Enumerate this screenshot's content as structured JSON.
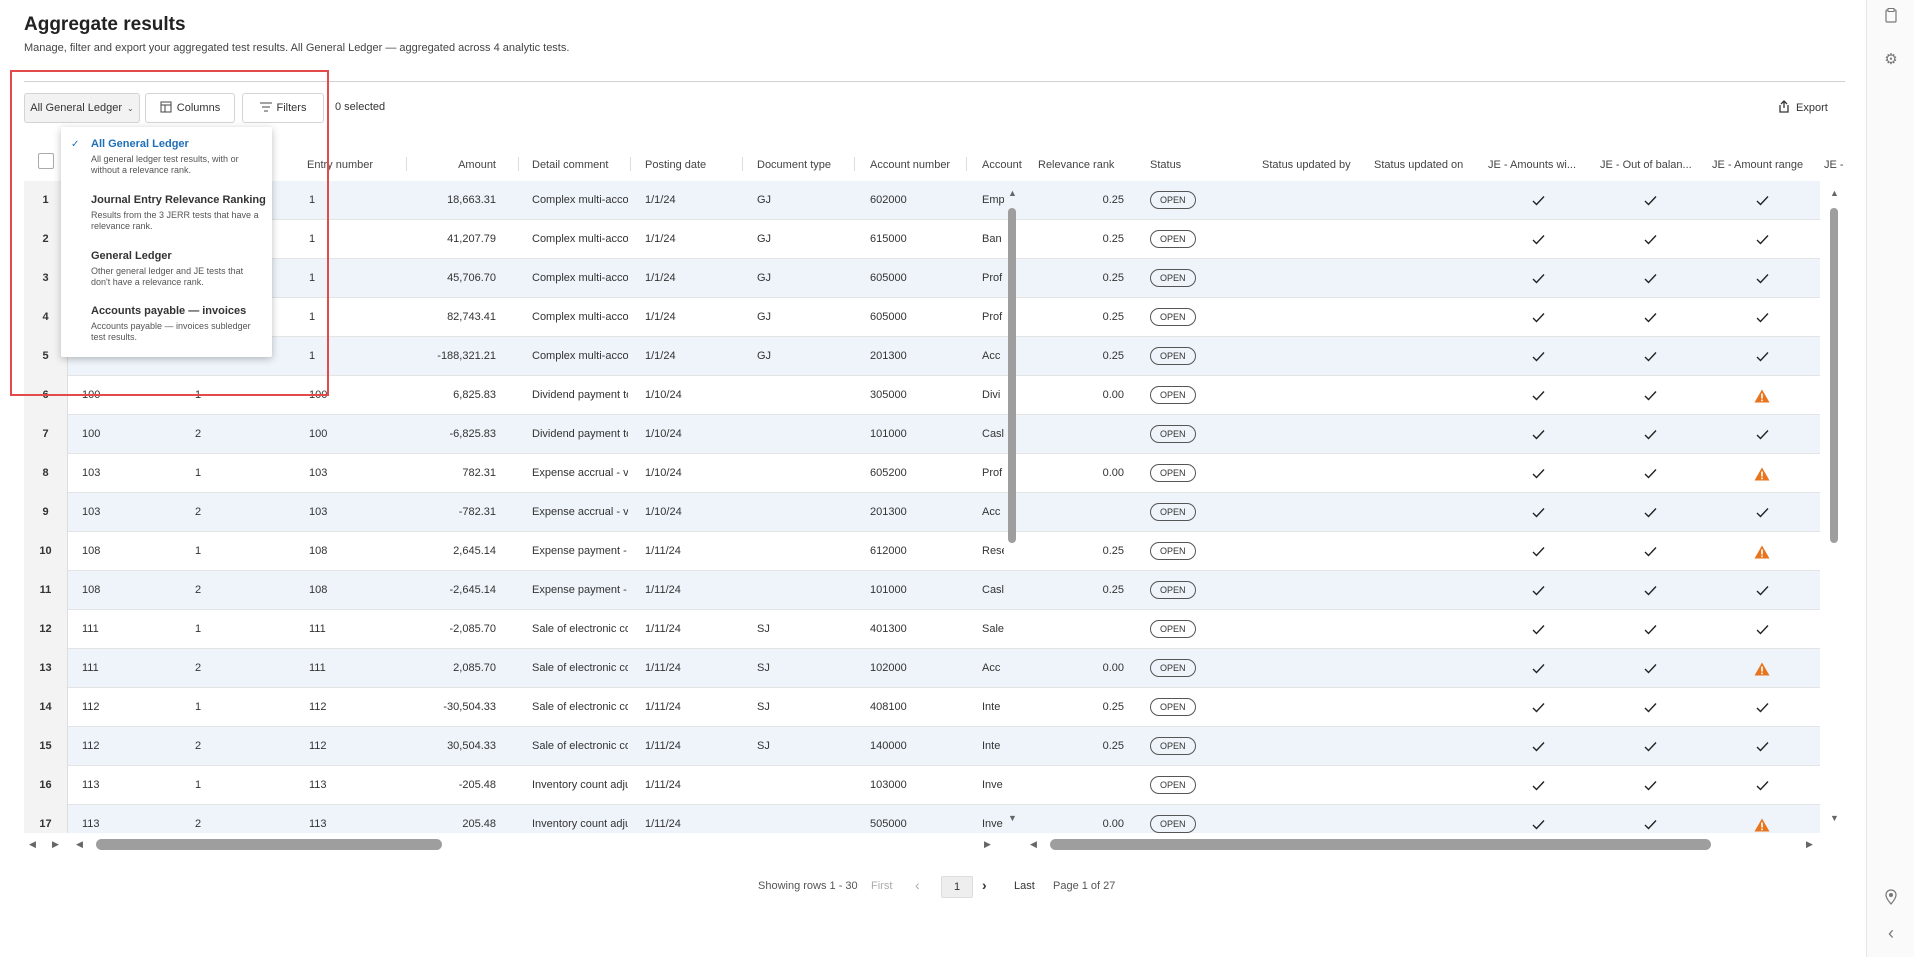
{
  "page": {
    "title": "Aggregate results",
    "description": "Manage, filter and export your aggregated test results. All General Ledger — aggregated across 4 analytic tests."
  },
  "toolbar": {
    "dataset_selector": "All General Ledger",
    "columns_label": "Columns",
    "filters_label": "Filters",
    "selected_count": "0 selected",
    "export_label": "Export"
  },
  "dropdown": {
    "items": [
      {
        "title": "All General Ledger",
        "description": "All general ledger test results, with or without a relevance rank.",
        "selected": true
      },
      {
        "title": "Journal Entry Relevance Ranking",
        "description": "Results from the 3 JERR tests that have a relevance rank.",
        "selected": false
      },
      {
        "title": "General Ledger",
        "description": "Other general ledger and JE tests that don't have a relevance rank.",
        "selected": false
      },
      {
        "title": "Accounts payable — invoices",
        "description": "Accounts payable — invoices subledger test results.",
        "selected": false
      }
    ]
  },
  "table": {
    "columns": {
      "entry_number": "Entry number",
      "amount": "Amount",
      "detail_comment": "Detail comment",
      "posting_date": "Posting date",
      "document_type": "Document type",
      "account_number": "Account number",
      "account": "Account",
      "relevance_rank": "Relevance rank",
      "status": "Status",
      "status_updated_by": "Status updated by",
      "status_updated_on": "Status updated on",
      "je_amounts": "JE - Amounts wi...",
      "je_out_of_balance": "JE - Out of balan...",
      "je_amount_range": "JE - Amount range",
      "je_more": "JE -"
    },
    "rows": [
      {
        "n": "1",
        "c1": "",
        "c2": "",
        "entry": "1",
        "amount": "18,663.31",
        "comment": "Complex multi-accou",
        "date": "1/1/24",
        "doc": "GJ",
        "acct_no": "602000",
        "acct": "Emp",
        "rank": "0.25",
        "status": "OPEN",
        "t1": "check",
        "t2": "check",
        "t3": "check"
      },
      {
        "n": "2",
        "c1": "",
        "c2": "",
        "entry": "1",
        "amount": "41,207.79",
        "comment": "Complex multi-accou",
        "date": "1/1/24",
        "doc": "GJ",
        "acct_no": "615000",
        "acct": "Ban",
        "rank": "0.25",
        "status": "OPEN",
        "t1": "check",
        "t2": "check",
        "t3": "check"
      },
      {
        "n": "3",
        "c1": "",
        "c2": "",
        "entry": "1",
        "amount": "45,706.70",
        "comment": "Complex multi-accou",
        "date": "1/1/24",
        "doc": "GJ",
        "acct_no": "605000",
        "acct": "Prof",
        "rank": "0.25",
        "status": "OPEN",
        "t1": "check",
        "t2": "check",
        "t3": "check"
      },
      {
        "n": "4",
        "c1": "",
        "c2": "",
        "entry": "1",
        "amount": "82,743.41",
        "comment": "Complex multi-accou",
        "date": "1/1/24",
        "doc": "GJ",
        "acct_no": "605000",
        "acct": "Prof",
        "rank": "0.25",
        "status": "OPEN",
        "t1": "check",
        "t2": "check",
        "t3": "check"
      },
      {
        "n": "5",
        "c1": "",
        "c2": "",
        "entry": "1",
        "amount": "-188,321.21",
        "comment": "Complex multi-accou",
        "date": "1/1/24",
        "doc": "GJ",
        "acct_no": "201300",
        "acct": "Acc",
        "rank": "0.25",
        "status": "OPEN",
        "t1": "check",
        "t2": "check",
        "t3": "check"
      },
      {
        "n": "6",
        "c1": "100",
        "c2": "1",
        "entry": "100",
        "amount": "6,825.83",
        "comment": "Dividend payment to",
        "date": "1/10/24",
        "doc": "",
        "acct_no": "305000",
        "acct": "Divi",
        "rank": "0.00",
        "status": "OPEN",
        "t1": "check",
        "t2": "check",
        "t3": "warn"
      },
      {
        "n": "7",
        "c1": "100",
        "c2": "2",
        "entry": "100",
        "amount": "-6,825.83",
        "comment": "Dividend payment to",
        "date": "1/10/24",
        "doc": "",
        "acct_no": "101000",
        "acct": "Casl",
        "rank": "",
        "status": "OPEN",
        "t1": "check",
        "t2": "check",
        "t3": "check"
      },
      {
        "n": "8",
        "c1": "103",
        "c2": "1",
        "entry": "103",
        "amount": "782.31",
        "comment": "Expense accrual - ver",
        "date": "1/10/24",
        "doc": "",
        "acct_no": "605200",
        "acct": "Prof",
        "rank": "0.00",
        "status": "OPEN",
        "t1": "check",
        "t2": "check",
        "t3": "warn"
      },
      {
        "n": "9",
        "c1": "103",
        "c2": "2",
        "entry": "103",
        "amount": "-782.31",
        "comment": "Expense accrual - ver",
        "date": "1/10/24",
        "doc": "",
        "acct_no": "201300",
        "acct": "Acc",
        "rank": "",
        "status": "OPEN",
        "t1": "check",
        "t2": "check",
        "t3": "check"
      },
      {
        "n": "10",
        "c1": "108",
        "c2": "1",
        "entry": "108",
        "amount": "2,645.14",
        "comment": "Expense payment - ve",
        "date": "1/11/24",
        "doc": "",
        "acct_no": "612000",
        "acct": "Rese",
        "rank": "0.25",
        "status": "OPEN",
        "t1": "check",
        "t2": "check",
        "t3": "warn"
      },
      {
        "n": "11",
        "c1": "108",
        "c2": "2",
        "entry": "108",
        "amount": "-2,645.14",
        "comment": "Expense payment - ve",
        "date": "1/11/24",
        "doc": "",
        "acct_no": "101000",
        "acct": "Casl",
        "rank": "0.25",
        "status": "OPEN",
        "t1": "check",
        "t2": "check",
        "t3": "check"
      },
      {
        "n": "12",
        "c1": "111",
        "c2": "1",
        "entry": "111",
        "amount": "-2,085.70",
        "comment": "Sale of electronic con",
        "date": "1/11/24",
        "doc": "SJ",
        "acct_no": "401300",
        "acct": "Sale",
        "rank": "",
        "status": "OPEN",
        "t1": "check",
        "t2": "check",
        "t3": "check"
      },
      {
        "n": "13",
        "c1": "111",
        "c2": "2",
        "entry": "111",
        "amount": "2,085.70",
        "comment": "Sale of electronic con",
        "date": "1/11/24",
        "doc": "SJ",
        "acct_no": "102000",
        "acct": "Acc",
        "rank": "0.00",
        "status": "OPEN",
        "t1": "check",
        "t2": "check",
        "t3": "warn"
      },
      {
        "n": "14",
        "c1": "112",
        "c2": "1",
        "entry": "112",
        "amount": "-30,504.33",
        "comment": "Sale of electronic con",
        "date": "1/11/24",
        "doc": "SJ",
        "acct_no": "408100",
        "acct": "Inte",
        "rank": "0.25",
        "status": "OPEN",
        "t1": "check",
        "t2": "check",
        "t3": "check"
      },
      {
        "n": "15",
        "c1": "112",
        "c2": "2",
        "entry": "112",
        "amount": "30,504.33",
        "comment": "Sale of electronic con",
        "date": "1/11/24",
        "doc": "SJ",
        "acct_no": "140000",
        "acct": "Inte",
        "rank": "0.25",
        "status": "OPEN",
        "t1": "check",
        "t2": "check",
        "t3": "check"
      },
      {
        "n": "16",
        "c1": "113",
        "c2": "1",
        "entry": "113",
        "amount": "-205.48",
        "comment": "Inventory count adjus",
        "date": "1/11/24",
        "doc": "",
        "acct_no": "103000",
        "acct": "Inve",
        "rank": "",
        "status": "OPEN",
        "t1": "check",
        "t2": "check",
        "t3": "check"
      },
      {
        "n": "17",
        "c1": "113",
        "c2": "2",
        "entry": "113",
        "amount": "205.48",
        "comment": "Inventory count adjus",
        "date": "1/11/24",
        "doc": "",
        "acct_no": "505000",
        "acct": "Inve",
        "rank": "0.00",
        "status": "OPEN",
        "t1": "check",
        "t2": "check",
        "t3": "warn"
      }
    ]
  },
  "pagination": {
    "showing": "Showing rows 1 - 30",
    "first": "First",
    "current": "1",
    "last": "Last",
    "page_of": "Page 1 of 27"
  },
  "colors": {
    "accent": "#1f6fb8",
    "warning": "#e8741e",
    "highlight": "#e34a4a"
  }
}
